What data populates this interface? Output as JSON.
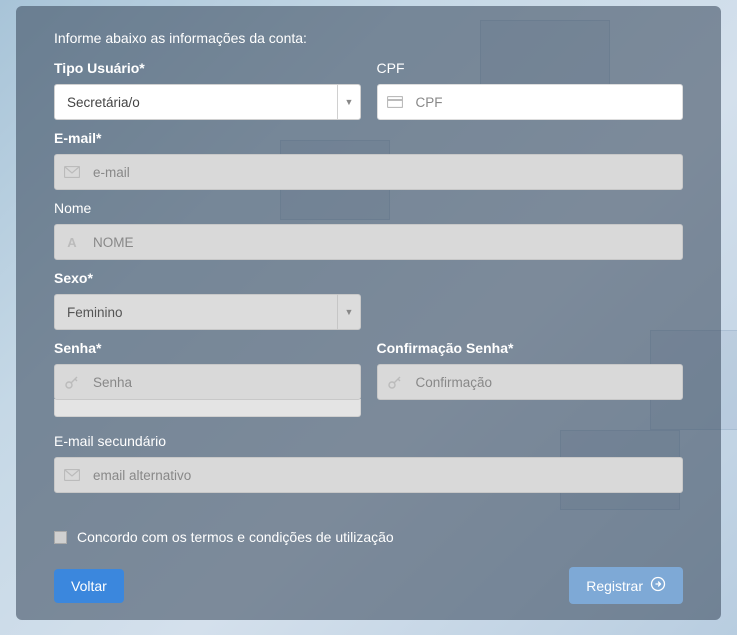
{
  "intro": "Informe abaixo as informações da conta:",
  "fields": {
    "user_type": {
      "label": "Tipo Usuário*",
      "value": "Secretária/o"
    },
    "cpf": {
      "label": "CPF",
      "placeholder": "CPF"
    },
    "email": {
      "label": "E-mail*",
      "placeholder": "e-mail"
    },
    "name": {
      "label": "Nome",
      "placeholder": "NOME"
    },
    "gender": {
      "label": "Sexo*",
      "value": "Feminino"
    },
    "password": {
      "label": "Senha*",
      "placeholder": "Senha"
    },
    "confirm": {
      "label": "Confirmação Senha*",
      "placeholder": "Confirmação"
    },
    "email2": {
      "label": "E-mail secundário",
      "placeholder": "email alternativo"
    }
  },
  "terms": {
    "label": "Concordo com os termos e condições de utilização"
  },
  "buttons": {
    "back": "Voltar",
    "register": "Registrar"
  }
}
